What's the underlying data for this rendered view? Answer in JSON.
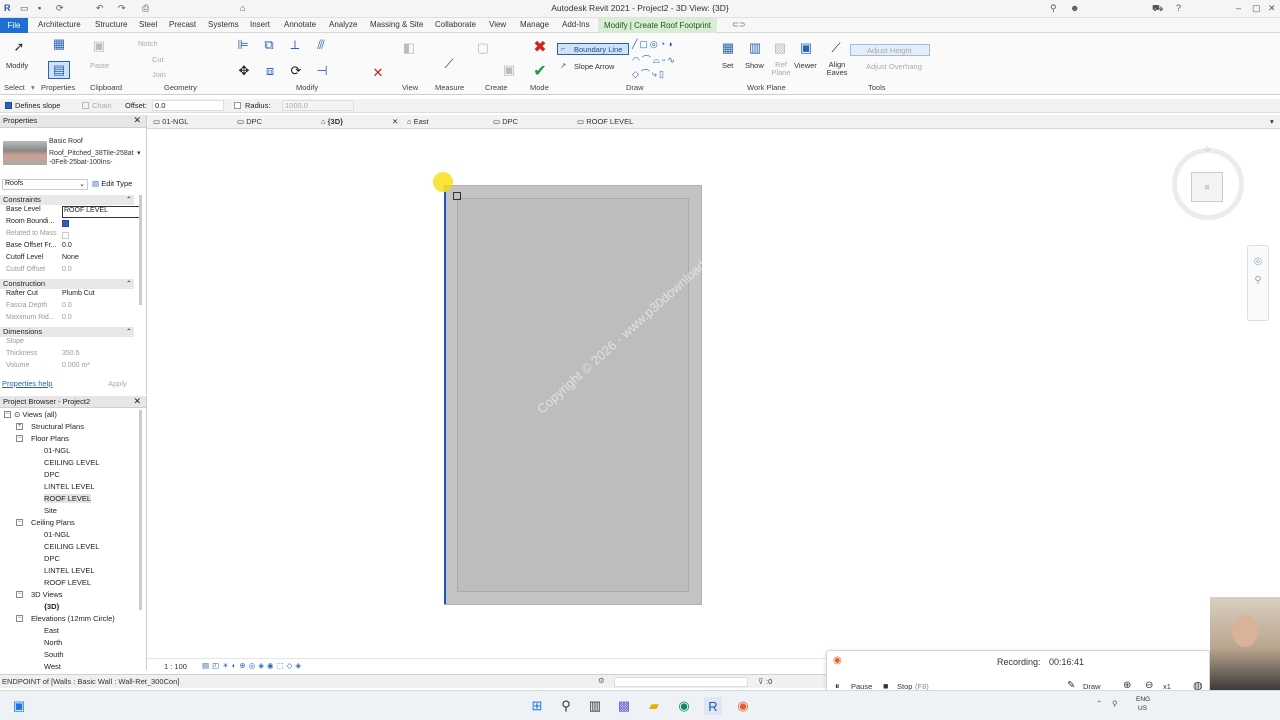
{
  "app_title": "Autodesk Revit 2021 - Project2 - 3D View: {3D}",
  "tabs": [
    "File",
    "Architecture",
    "Structure",
    "Steel",
    "Precast",
    "Systems",
    "Insert",
    "Annotate",
    "Analyze",
    "Massing & Site",
    "Collaborate",
    "View",
    "Manage",
    "Add-Ins",
    "Modify | Create Roof Footprint"
  ],
  "ribbon": {
    "modify": "Modify",
    "select": "Select",
    "properties": "Properties",
    "clipboard": "Clipboard",
    "geometry": "Geometry",
    "modify_panel": "Modify",
    "view": "View",
    "measure": "Measure",
    "create": "Create",
    "mode": "Mode",
    "draw": "Draw",
    "work_plane": "Work Plane",
    "tools": "Tools",
    "paste": "Paste",
    "notch": "Notch",
    "cut": "Cut",
    "join": "Join",
    "boundary_line": "Boundary Line",
    "slope_arrow": "Slope Arrow",
    "set": "Set",
    "show": "Show",
    "ref_plane": "Ref Plane",
    "viewer": "Viewer",
    "align_eaves": "Align Eaves",
    "adjust_height": "Adjust Height",
    "adjust_overhang": "Adjust Overhang"
  },
  "options_bar": {
    "defines_slope": "Defines slope",
    "chain": "Chain",
    "offset_label": "Offset:",
    "offset_value": "0.0",
    "radius_label": "Radius:",
    "radius_value": "1000.0"
  },
  "view_tabs": [
    "01-NGL",
    "DPC",
    "{3D}",
    "East",
    "DPC",
    "ROOF LEVEL"
  ],
  "properties": {
    "header": "Properties",
    "type_family": "Basic Roof",
    "type_name": "Roof_Pitched_38Tile-258at-0Felt-25bat-100Ins-",
    "category": "Roofs",
    "edit_type": "Edit Type",
    "sections": {
      "constraints": "Constraints",
      "construction": "Construction",
      "dimensions": "Dimensions"
    },
    "rows": {
      "base_level": {
        "k": "Base Level",
        "v": "ROOF LEVEL"
      },
      "room_bounding": {
        "k": "Room Boundi...",
        "v": ""
      },
      "related_to_mass": {
        "k": "Related to Mass",
        "v": ""
      },
      "base_offset": {
        "k": "Base Offset Fr...",
        "v": "0.0"
      },
      "cutoff_level": {
        "k": "Cutoff Level",
        "v": "None"
      },
      "cutoff_offset": {
        "k": "Cutoff Offset",
        "v": "0.0"
      },
      "rafter_cut": {
        "k": "Rafter Cut",
        "v": "Plumb Cut"
      },
      "fascia_depth": {
        "k": "Fascia Depth",
        "v": "0.0"
      },
      "maximum_ridge": {
        "k": "Maximum Rid...",
        "v": "0.0"
      },
      "slope": {
        "k": "Slope",
        "v": ""
      },
      "thickness": {
        "k": "Thickness",
        "v": "350.5"
      },
      "volume": {
        "k": "Volume",
        "v": "0.000 m³"
      }
    },
    "help": "Properties help",
    "apply": "Apply"
  },
  "browser": {
    "header": "Project Browser - Project2",
    "nodes": [
      "Views (all)",
      "Structural Plans",
      "Floor Plans",
      "01-NGL",
      "CEILING LEVEL",
      "DPC",
      "LINTEL LEVEL",
      "ROOF LEVEL",
      "Site",
      "Ceiling Plans",
      "01-NGL",
      "CEILING LEVEL",
      "DPC",
      "LINTEL LEVEL",
      "ROOF LEVEL",
      "3D Views",
      "{3D}",
      "Elevations (12mm Circle)",
      "East",
      "North",
      "South",
      "West"
    ]
  },
  "status": {
    "message": "ENDPOINT of [Walls : Basic Wall : Wall-Ret_300Con]",
    "scale": "1 : 100",
    "zero": ":0"
  },
  "recording": {
    "label": "Recording:",
    "time": "00:16:41",
    "pause": "Pause",
    "stop": "Stop",
    "stop_key": "(F8)",
    "draw": "Draw",
    "zoom": "x1"
  },
  "watermark": "Copyright © 2026 - www.p30download.com",
  "tray": {
    "lang": "ENG",
    "region": "US"
  }
}
